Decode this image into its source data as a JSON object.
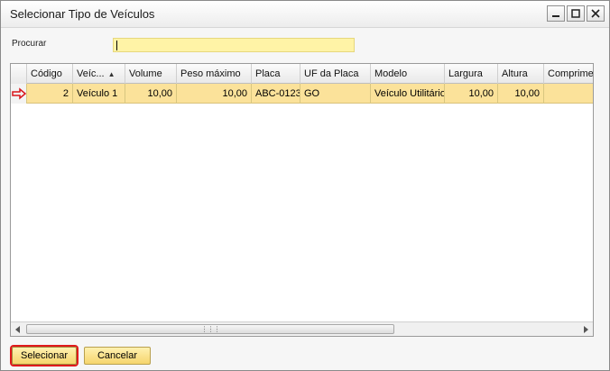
{
  "window": {
    "title": "Selecionar Tipo de Veículos"
  },
  "search": {
    "label": "Procurar",
    "value": ""
  },
  "grid": {
    "columns": [
      "Código",
      "Veíc...",
      "Volume",
      "Peso máximo",
      "Placa",
      "UF da Placa",
      "Modelo",
      "Largura",
      "Altura",
      "Comprime"
    ],
    "sorted_column": "Veíc...",
    "rows": [
      [
        "2",
        "Veículo 1",
        "10,00",
        "10,00",
        "ABC-0123",
        "GO",
        "Veículo Utilitário",
        "10,00",
        "10,00",
        ""
      ]
    ],
    "selected_row_color": "#fbe29a"
  },
  "buttons": {
    "select": "Selecionar",
    "cancel": "Cancelar"
  },
  "icons": {
    "minimize": "minimize-icon",
    "maximize": "maximize-icon",
    "close": "close-icon",
    "row_marker": "arrow-right-icon",
    "sort": "sort-up-icon",
    "scroll_left": "arrow-left-icon",
    "scroll_right": "arrow-right-icon"
  },
  "colors": {
    "accent": "#f6d56d",
    "input_bg": "#fff3a6",
    "highlight_border": "#e0191c"
  }
}
